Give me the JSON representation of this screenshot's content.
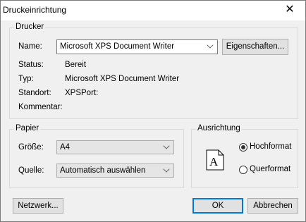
{
  "window": {
    "title": "Druckeinrichtung",
    "close_glyph": "✕"
  },
  "printer": {
    "group_label": "Drucker",
    "name_label": "Name:",
    "name_value": "Microsoft XPS Document Writer",
    "properties_button": "Eigenschaften...",
    "status_label": "Status:",
    "status_value": "Bereit",
    "type_label": "Typ:",
    "type_value": "Microsoft XPS Document Writer",
    "location_label": "Standort:",
    "location_value": "XPSPort:",
    "comment_label": "Kommentar:",
    "comment_value": ""
  },
  "paper": {
    "group_label": "Papier",
    "size_label": "Größe:",
    "size_value": "A4",
    "source_label": "Quelle:",
    "source_value": "Automatisch auswählen"
  },
  "orientation": {
    "group_label": "Ausrichtung",
    "portrait_label": "Hochformat",
    "landscape_label": "Querformat",
    "selected": "portrait",
    "icon_letter": "A"
  },
  "footer": {
    "network_button": "Netzwerk...",
    "ok_button": "OK",
    "cancel_button": "Abbrechen"
  },
  "icons": {
    "close": "close-icon",
    "dropdown": "chevron-down-icon",
    "page": "page-portrait-icon"
  }
}
